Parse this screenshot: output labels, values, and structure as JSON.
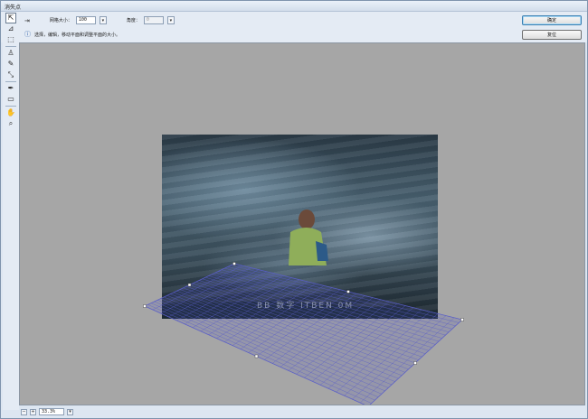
{
  "window": {
    "title": "消失点"
  },
  "options": {
    "grid_size_label": "网格大小：",
    "grid_size_value": "100",
    "angle_label": "角度：",
    "angle_value": "0",
    "hint_text": "选择，编辑，移动平面和调整平面的大小。"
  },
  "buttons": {
    "ok": "确定",
    "reset": "复位"
  },
  "tools": [
    {
      "name": "edit-plane-tool",
      "icon": "arrow-cursor-icon",
      "glyph": "⇱"
    },
    {
      "name": "create-plane-tool",
      "icon": "create-plane-icon",
      "glyph": "⊿"
    },
    {
      "name": "marquee-tool",
      "icon": "marquee-icon",
      "glyph": "⬚"
    },
    {
      "name": "stamp-tool",
      "icon": "stamp-icon",
      "glyph": "♙"
    },
    {
      "name": "brush-tool",
      "icon": "brush-icon",
      "glyph": "✎"
    },
    {
      "name": "transform-tool",
      "icon": "transform-icon",
      "glyph": "⤡"
    },
    {
      "name": "eyedropper-tool",
      "icon": "eyedropper-icon",
      "glyph": "✒"
    },
    {
      "name": "measure-tool",
      "icon": "ruler-icon",
      "glyph": "▭"
    },
    {
      "name": "hand-tool",
      "icon": "hand-icon",
      "glyph": "✋"
    },
    {
      "name": "zoom-tool",
      "icon": "zoom-icon",
      "glyph": "⌕"
    }
  ],
  "statusbar": {
    "zoom": "33.3%"
  },
  "watermark": "BB 数字 ITBEN 0M",
  "colors": {
    "grid": "#5a5ec8",
    "canvas_bg": "#a6a6a6"
  }
}
